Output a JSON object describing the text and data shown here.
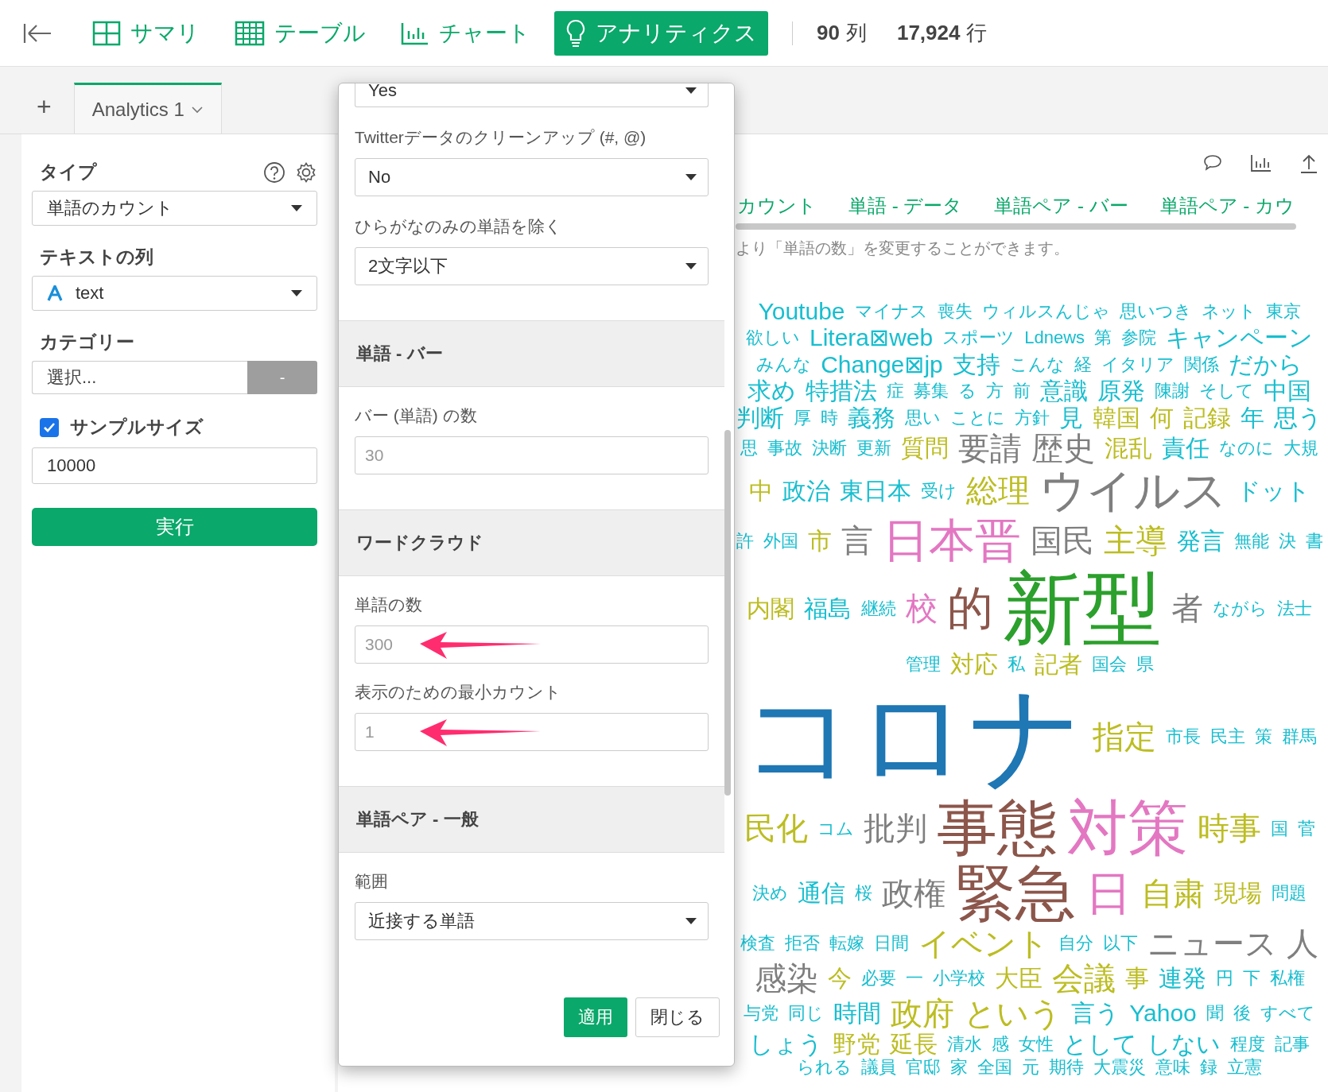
{
  "topbar": {
    "tabs": [
      {
        "label": "サマリ",
        "selected": false
      },
      {
        "label": "テーブル",
        "selected": false
      },
      {
        "label": "チャート",
        "selected": false
      },
      {
        "label": "アナリティクス",
        "selected": true
      }
    ],
    "stats": [
      {
        "value": "90",
        "unit": "列"
      },
      {
        "value": "17,924",
        "unit": "行"
      }
    ]
  },
  "add_tab": "+",
  "analytics_tabs": [
    {
      "label": "Analytics 1",
      "selected": true
    }
  ],
  "sidebar": {
    "type_label": "タイプ",
    "type_value": "単語のカウント",
    "text_column_label": "テキストの列",
    "text_column_value": "text",
    "category_label": "カテゴリー",
    "category_placeholder": "選択...",
    "category_button": "-",
    "sample_size": {
      "label": "サンプルサイズ",
      "checked": true,
      "value": "10000"
    },
    "run_button": "実行"
  },
  "main": {
    "tabs": [
      "カウント",
      "単語 - データ",
      "単語ペア - バー",
      "単語ペア - カウ"
    ],
    "description": "より「単語の数」を変更することができます。",
    "word_cloud": [
      {
        "text": "Youtube",
        "kind": "minor",
        "color": "#17becf"
      },
      {
        "text": "マイナス",
        "kind": "tiny",
        "color": "#17becf"
      },
      {
        "text": "喪失",
        "kind": "tiny",
        "color": "#17becf"
      },
      {
        "text": "ウィルスんじゃ",
        "kind": "tiny",
        "color": "#17becf"
      },
      {
        "text": "思いつき",
        "kind": "tiny",
        "color": "#17becf"
      },
      {
        "text": "ネット",
        "kind": "tiny",
        "color": "#17becf"
      },
      {
        "text": "東京",
        "kind": "tiny",
        "color": "#17becf"
      },
      {
        "text": "欲しい",
        "kind": "tiny",
        "color": "#17becf"
      },
      {
        "text": "Litera⊠web",
        "kind": "minor",
        "color": "#17becf"
      },
      {
        "text": "スポーツ",
        "kind": "tiny",
        "color": "#17becf"
      },
      {
        "text": "Ldnews",
        "kind": "tiny",
        "color": "#17becf"
      },
      {
        "text": "第",
        "kind": "tiny",
        "color": "#17becf"
      },
      {
        "text": "参院",
        "kind": "tiny",
        "color": "#17becf"
      },
      {
        "text": "キャンペーン",
        "kind": "minor",
        "color": "#17becf"
      },
      {
        "text": "みんな",
        "kind": "tiny",
        "color": "#17becf"
      },
      {
        "text": "Change⊠jp",
        "kind": "minor",
        "color": "#17becf"
      },
      {
        "text": "支持",
        "kind": "minor",
        "color": "#17becf"
      },
      {
        "text": "こんな",
        "kind": "tiny",
        "color": "#17becf"
      },
      {
        "text": "経",
        "kind": "tiny",
        "color": "#17becf"
      },
      {
        "text": "イタリア",
        "kind": "tiny",
        "color": "#17becf"
      },
      {
        "text": "関係",
        "kind": "tiny",
        "color": "#17becf"
      },
      {
        "text": "だから",
        "kind": "minor",
        "color": "#17becf"
      },
      {
        "text": "求め",
        "kind": "minor",
        "color": "#17becf"
      },
      {
        "text": "特措法",
        "kind": "minor",
        "color": "#17becf"
      },
      {
        "text": "症",
        "kind": "tiny",
        "color": "#17becf"
      },
      {
        "text": "募集",
        "kind": "tiny",
        "color": "#17becf"
      },
      {
        "text": "る",
        "kind": "tiny",
        "color": "#17becf"
      },
      {
        "text": "方",
        "kind": "tiny",
        "color": "#17becf"
      },
      {
        "text": "前",
        "kind": "tiny",
        "color": "#17becf"
      },
      {
        "text": "意識",
        "kind": "minor",
        "color": "#17becf"
      },
      {
        "text": "原発",
        "kind": "minor",
        "color": "#17becf"
      },
      {
        "text": "陳謝",
        "kind": "tiny",
        "color": "#17becf"
      },
      {
        "text": "そして",
        "kind": "tiny",
        "color": "#17becf"
      },
      {
        "text": "中国",
        "kind": "minor",
        "color": "#17becf"
      },
      {
        "text": "判断",
        "kind": "minor",
        "color": "#17becf"
      },
      {
        "text": "厚",
        "kind": "tiny",
        "color": "#17becf"
      },
      {
        "text": "時",
        "kind": "tiny",
        "color": "#17becf"
      },
      {
        "text": "義務",
        "kind": "minor",
        "color": "#17becf"
      },
      {
        "text": "思い",
        "kind": "tiny",
        "color": "#17becf"
      },
      {
        "text": "ことに",
        "kind": "tiny",
        "color": "#17becf"
      },
      {
        "text": "方針",
        "kind": "tiny",
        "color": "#17becf"
      },
      {
        "text": "見",
        "kind": "minor",
        "color": "#17becf"
      },
      {
        "text": "韓国",
        "kind": "minor",
        "color": "#bcbd22"
      },
      {
        "text": "何",
        "kind": "minor",
        "color": "#bcbd22"
      },
      {
        "text": "記録",
        "kind": "minor",
        "color": "#bcbd22"
      },
      {
        "text": "年",
        "kind": "minor",
        "color": "#17becf"
      },
      {
        "text": "思う",
        "kind": "minor",
        "color": "#17becf"
      },
      {
        "text": "思",
        "kind": "tiny",
        "color": "#17becf"
      },
      {
        "text": "事故",
        "kind": "tiny",
        "color": "#17becf"
      },
      {
        "text": "決断",
        "kind": "tiny",
        "color": "#17becf"
      },
      {
        "text": "更新",
        "kind": "tiny",
        "color": "#17becf"
      },
      {
        "text": "質問",
        "kind": "minor",
        "color": "#bcbd22"
      },
      {
        "text": "要請",
        "kind": "small",
        "color": "#7f7f7f"
      },
      {
        "text": "歴史",
        "kind": "small",
        "color": "#7f7f7f"
      },
      {
        "text": "混乱",
        "kind": "minor",
        "color": "#bcbd22"
      },
      {
        "text": "責任",
        "kind": "minor",
        "color": "#17becf"
      },
      {
        "text": "なのに",
        "kind": "tiny",
        "color": "#17becf"
      },
      {
        "text": "大規",
        "kind": "tiny",
        "color": "#17becf"
      },
      {
        "text": "中",
        "kind": "minor",
        "color": "#bcbd22"
      },
      {
        "text": "政治",
        "kind": "minor",
        "color": "#17becf"
      },
      {
        "text": "東日本",
        "kind": "minor",
        "color": "#17becf"
      },
      {
        "text": "受け",
        "kind": "tiny",
        "color": "#17becf"
      },
      {
        "text": "総理",
        "kind": "small",
        "color": "#bcbd22"
      },
      {
        "text": "ウイルス",
        "kind": "medium",
        "color": "#7f7f7f"
      },
      {
        "text": "ドット",
        "kind": "minor",
        "color": "#17becf"
      },
      {
        "text": "許",
        "kind": "tiny",
        "color": "#17becf"
      },
      {
        "text": "外国",
        "kind": "tiny",
        "color": "#17becf"
      },
      {
        "text": "市",
        "kind": "minor",
        "color": "#bcbd22"
      },
      {
        "text": "言",
        "kind": "small",
        "color": "#7f7f7f"
      },
      {
        "text": "日本晋",
        "kind": "medium",
        "color": "#e377c2"
      },
      {
        "text": "国民",
        "kind": "small",
        "color": "#7f7f7f"
      },
      {
        "text": "主導",
        "kind": "small",
        "color": "#bcbd22"
      },
      {
        "text": "発言",
        "kind": "minor",
        "color": "#17becf"
      },
      {
        "text": "無能",
        "kind": "tiny",
        "color": "#17becf"
      },
      {
        "text": "決",
        "kind": "tiny",
        "color": "#17becf"
      },
      {
        "text": "書",
        "kind": "tiny",
        "color": "#17becf"
      },
      {
        "text": "内閣",
        "kind": "minor",
        "color": "#bcbd22"
      },
      {
        "text": "福島",
        "kind": "minor",
        "color": "#17becf"
      },
      {
        "text": "継続",
        "kind": "tiny",
        "color": "#17becf"
      },
      {
        "text": "校",
        "kind": "small",
        "color": "#e377c2"
      },
      {
        "text": "的",
        "kind": "medium",
        "color": "#8c564b"
      },
      {
        "text": "新型",
        "kind": "large",
        "color": "#2ca02c"
      },
      {
        "text": "者",
        "kind": "small",
        "color": "#7f7f7f"
      },
      {
        "text": "ながら",
        "kind": "tiny",
        "color": "#17becf"
      },
      {
        "text": "法士",
        "kind": "tiny",
        "color": "#17becf"
      },
      {
        "text": "管理",
        "kind": "tiny",
        "color": "#17becf"
      },
      {
        "text": "対応",
        "kind": "minor",
        "color": "#bcbd22"
      },
      {
        "text": "私",
        "kind": "tiny",
        "color": "#17becf"
      },
      {
        "text": "記者",
        "kind": "minor",
        "color": "#bcbd22"
      },
      {
        "text": "国会",
        "kind": "tiny",
        "color": "#17becf"
      },
      {
        "text": "県",
        "kind": "tiny",
        "color": "#17becf"
      },
      {
        "text": "コロナ",
        "kind": "huge",
        "color": "#1f77b4"
      },
      {
        "text": "指定",
        "kind": "small",
        "color": "#bcbd22"
      },
      {
        "text": "市長",
        "kind": "tiny",
        "color": "#17becf"
      },
      {
        "text": "民主",
        "kind": "tiny",
        "color": "#17becf"
      },
      {
        "text": "策",
        "kind": "tiny",
        "color": "#17becf"
      },
      {
        "text": "群馬",
        "kind": "tiny",
        "color": "#17becf"
      },
      {
        "text": "民化",
        "kind": "small",
        "color": "#bcbd22"
      },
      {
        "text": "コム",
        "kind": "tiny",
        "color": "#17becf"
      },
      {
        "text": "批判",
        "kind": "small",
        "color": "#7f7f7f"
      },
      {
        "text": "事態",
        "kind": "big",
        "color": "#8c564b"
      },
      {
        "text": "対策",
        "kind": "big",
        "color": "#e377c2"
      },
      {
        "text": "時事",
        "kind": "small",
        "color": "#bcbd22"
      },
      {
        "text": "国",
        "kind": "tiny",
        "color": "#17becf"
      },
      {
        "text": "菅",
        "kind": "tiny",
        "color": "#17becf"
      },
      {
        "text": "決め",
        "kind": "tiny",
        "color": "#17becf"
      },
      {
        "text": "通信",
        "kind": "minor",
        "color": "#17becf"
      },
      {
        "text": "桜",
        "kind": "tiny",
        "color": "#17becf"
      },
      {
        "text": "政権",
        "kind": "small",
        "color": "#7f7f7f"
      },
      {
        "text": "緊急",
        "kind": "big",
        "color": "#8c564b"
      },
      {
        "text": "日",
        "kind": "medium",
        "color": "#e377c2"
      },
      {
        "text": "自粛",
        "kind": "small",
        "color": "#bcbd22"
      },
      {
        "text": "現場",
        "kind": "minor",
        "color": "#bcbd22"
      },
      {
        "text": "問題",
        "kind": "tiny",
        "color": "#17becf"
      },
      {
        "text": "検査",
        "kind": "tiny",
        "color": "#17becf"
      },
      {
        "text": "拒否",
        "kind": "tiny",
        "color": "#17becf"
      },
      {
        "text": "転嫁",
        "kind": "tiny",
        "color": "#17becf"
      },
      {
        "text": "日間",
        "kind": "tiny",
        "color": "#17becf"
      },
      {
        "text": "イベント",
        "kind": "small",
        "color": "#bcbd22"
      },
      {
        "text": "自分",
        "kind": "tiny",
        "color": "#17becf"
      },
      {
        "text": "以下",
        "kind": "tiny",
        "color": "#17becf"
      },
      {
        "text": "ニュース",
        "kind": "small",
        "color": "#7f7f7f"
      },
      {
        "text": "人",
        "kind": "small",
        "color": "#7f7f7f"
      },
      {
        "text": "感染",
        "kind": "small",
        "color": "#7f7f7f"
      },
      {
        "text": "今",
        "kind": "minor",
        "color": "#bcbd22"
      },
      {
        "text": "必要",
        "kind": "tiny",
        "color": "#17becf"
      },
      {
        "text": "一",
        "kind": "tiny",
        "color": "#17becf"
      },
      {
        "text": "小学校",
        "kind": "tiny",
        "color": "#17becf"
      },
      {
        "text": "大臣",
        "kind": "minor",
        "color": "#bcbd22"
      },
      {
        "text": "会議",
        "kind": "small",
        "color": "#bcbd22"
      },
      {
        "text": "事",
        "kind": "minor",
        "color": "#bcbd22"
      },
      {
        "text": "連発",
        "kind": "minor",
        "color": "#17becf"
      },
      {
        "text": "円",
        "kind": "tiny",
        "color": "#17becf"
      },
      {
        "text": "下",
        "kind": "tiny",
        "color": "#17becf"
      },
      {
        "text": "私権",
        "kind": "tiny",
        "color": "#17becf"
      },
      {
        "text": "与党",
        "kind": "tiny",
        "color": "#17becf"
      },
      {
        "text": "同じ",
        "kind": "tiny",
        "color": "#17becf"
      },
      {
        "text": "時間",
        "kind": "minor",
        "color": "#17becf"
      },
      {
        "text": "政府",
        "kind": "small",
        "color": "#bcbd22"
      },
      {
        "text": "という",
        "kind": "small",
        "color": "#bcbd22"
      },
      {
        "text": "言う",
        "kind": "minor",
        "color": "#17becf"
      },
      {
        "text": "Yahoo",
        "kind": "minor",
        "color": "#17becf"
      },
      {
        "text": "聞",
        "kind": "tiny",
        "color": "#17becf"
      },
      {
        "text": "後",
        "kind": "tiny",
        "color": "#17becf"
      },
      {
        "text": "すべて",
        "kind": "tiny",
        "color": "#17becf"
      },
      {
        "text": "しょう",
        "kind": "minor",
        "color": "#17becf"
      },
      {
        "text": "野党",
        "kind": "minor",
        "color": "#bcbd22"
      },
      {
        "text": "延長",
        "kind": "minor",
        "color": "#bcbd22"
      },
      {
        "text": "清水",
        "kind": "tiny",
        "color": "#17becf"
      },
      {
        "text": "感",
        "kind": "tiny",
        "color": "#17becf"
      },
      {
        "text": "女性",
        "kind": "tiny",
        "color": "#17becf"
      },
      {
        "text": "として",
        "kind": "minor",
        "color": "#17becf"
      },
      {
        "text": "しない",
        "kind": "minor",
        "color": "#17becf"
      },
      {
        "text": "程度",
        "kind": "tiny",
        "color": "#17becf"
      },
      {
        "text": "記事",
        "kind": "tiny",
        "color": "#17becf"
      },
      {
        "text": "られる",
        "kind": "tiny",
        "color": "#17becf"
      },
      {
        "text": "議員",
        "kind": "tiny",
        "color": "#17becf"
      },
      {
        "text": "官邸",
        "kind": "tiny",
        "color": "#17becf"
      },
      {
        "text": "家",
        "kind": "tiny",
        "color": "#17becf"
      },
      {
        "text": "全国",
        "kind": "tiny",
        "color": "#17becf"
      },
      {
        "text": "元",
        "kind": "tiny",
        "color": "#17becf"
      },
      {
        "text": "期待",
        "kind": "tiny",
        "color": "#17becf"
      },
      {
        "text": "大震災",
        "kind": "tiny",
        "color": "#17becf"
      },
      {
        "text": "意味",
        "kind": "tiny",
        "color": "#17becf"
      },
      {
        "text": "録",
        "kind": "tiny",
        "color": "#17becf"
      },
      {
        "text": "立憲",
        "kind": "tiny",
        "color": "#17becf"
      }
    ]
  },
  "settings_popup": {
    "groups": [
      {
        "fields": [
          {
            "kind": "select",
            "value": "Yes"
          },
          {
            "kind": "select",
            "label": "Twitterデータのクリーンアップ (#, @)",
            "value": "No"
          },
          {
            "kind": "select",
            "label": "ひらがなのみの単語を除く",
            "value": "2文字以下"
          }
        ]
      },
      {
        "title": "単語 - バー",
        "fields": [
          {
            "kind": "input",
            "label": "バー (単語) の数",
            "placeholder": "30",
            "arrow": false
          }
        ]
      },
      {
        "title": "ワードクラウド",
        "fields": [
          {
            "kind": "input",
            "label": "単語の数",
            "placeholder": "300",
            "arrow": true
          },
          {
            "kind": "input",
            "label": "表示のための最小カウント",
            "placeholder": "1",
            "arrow": true
          }
        ]
      },
      {
        "title": "単語ペア - 一般",
        "fields": [
          {
            "kind": "select",
            "label": "範囲",
            "value": "近接する単語"
          }
        ]
      }
    ],
    "buttons": [
      {
        "label": "適用",
        "kind": "primary"
      },
      {
        "label": "閉じる",
        "kind": "default"
      }
    ]
  }
}
